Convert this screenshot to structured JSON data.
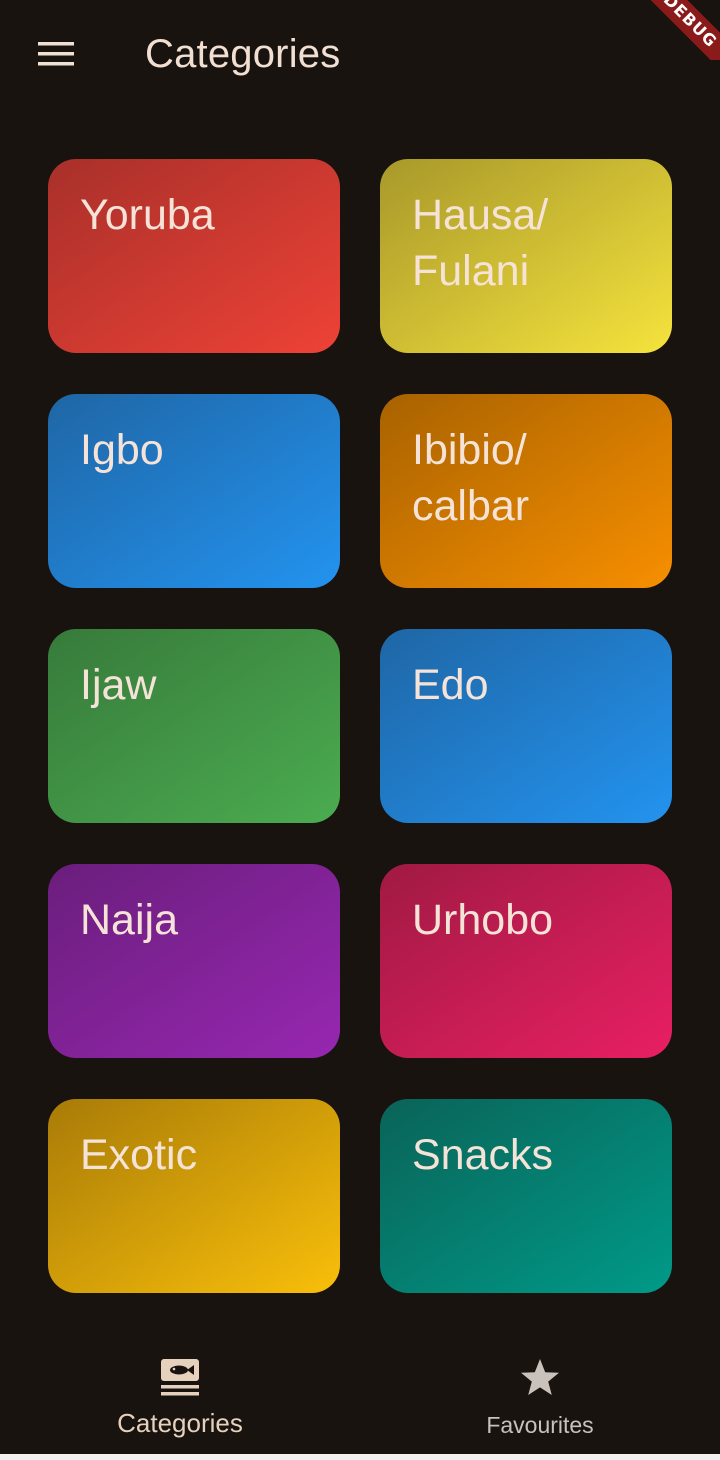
{
  "app_bar": {
    "title": "Categories",
    "menu_icon": "menu-icon"
  },
  "debug_banner": {
    "text": "DEBUG"
  },
  "categories": [
    {
      "label": "Yoruba",
      "color_start": "#A8302A",
      "color_end": "#EE4236"
    },
    {
      "label": "Hausa/ Fulani",
      "color_start": "#A8982A",
      "color_end": "#F5E33D"
    },
    {
      "label": "Igbo",
      "color_start": "#1F66A5",
      "color_end": "#2393EF"
    },
    {
      "label": "Ibibio/ calbar",
      "color_start": "#A86200",
      "color_end": "#F78F00"
    },
    {
      "label": "Ijaw",
      "color_start": "#377A3B",
      "color_end": "#4BAC50"
    },
    {
      "label": "Edo",
      "color_start": "#1F66A5",
      "color_end": "#2393EF"
    },
    {
      "label": "Naija",
      "color_start": "#6A1E7C",
      "color_end": "#9727B1"
    },
    {
      "label": "Urhobo",
      "color_start": "#A01A43",
      "color_end": "#E81F63"
    },
    {
      "label": "Exotic",
      "color_start": "#A87B08",
      "color_end": "#F9BF0A"
    },
    {
      "label": "Snacks",
      "color_start": "#0A6358",
      "color_end": "#009A88"
    }
  ],
  "bottom_nav": {
    "items": [
      {
        "label": "Categories",
        "icon": "set-meal-icon",
        "active": true
      },
      {
        "label": "Favourites",
        "icon": "star-icon",
        "active": false
      }
    ]
  }
}
